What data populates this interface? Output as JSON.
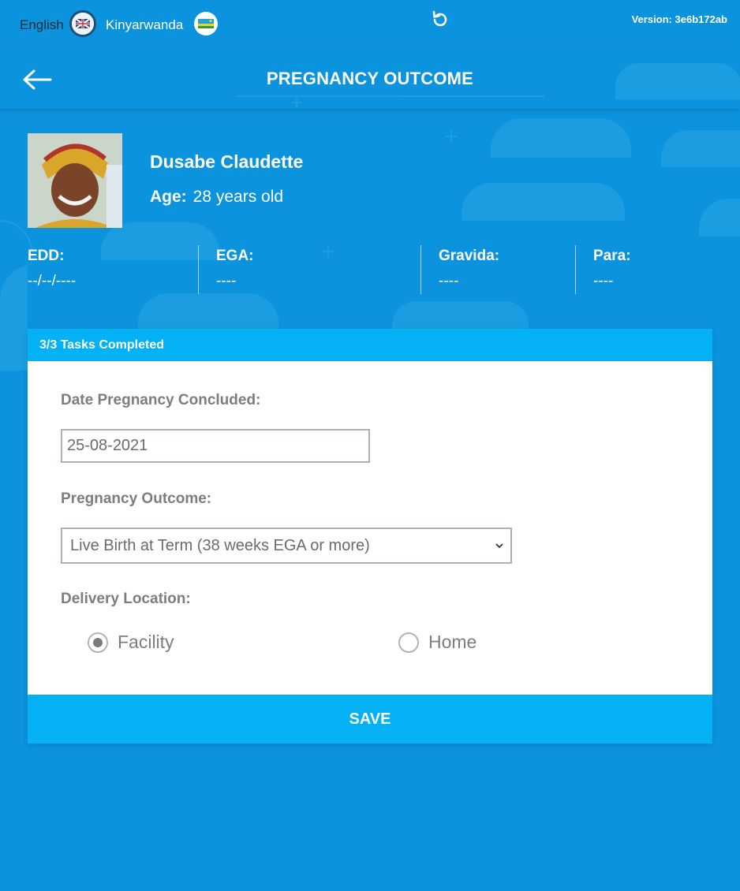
{
  "top_bar": {
    "lang_english": "English",
    "lang_kinyarwanda": "Kinyarwanda",
    "version": "Version: 3e6b172ab"
  },
  "header": {
    "title": "PREGNANCY OUTCOME"
  },
  "patient": {
    "name": "Dusabe Claudette",
    "age_label": "Age:",
    "age_value": "28 years old"
  },
  "stats": [
    {
      "label": "EDD:",
      "value": "--/--/----"
    },
    {
      "label": "EGA:",
      "value": "----"
    },
    {
      "label": "Gravida:",
      "value": "----"
    },
    {
      "label": "Para:",
      "value": "----"
    }
  ],
  "card": {
    "progress": "3/3 Tasks Completed",
    "date_label": "Date Pregnancy Concluded:",
    "date_value": "25-08-2021",
    "outcome_label": "Pregnancy Outcome:",
    "outcome_selected": "Live Birth at Term (38 weeks EGA or more)",
    "location_label": "Delivery Location:",
    "options": [
      {
        "label": "Facility",
        "checked": true
      },
      {
        "label": "Home",
        "checked": false
      }
    ],
    "save_label": "SAVE"
  },
  "colors": {
    "background": "#0b93dd",
    "accent": "#03b1f4",
    "card": "#ffffff",
    "label_gray": "#7d7d7d"
  }
}
